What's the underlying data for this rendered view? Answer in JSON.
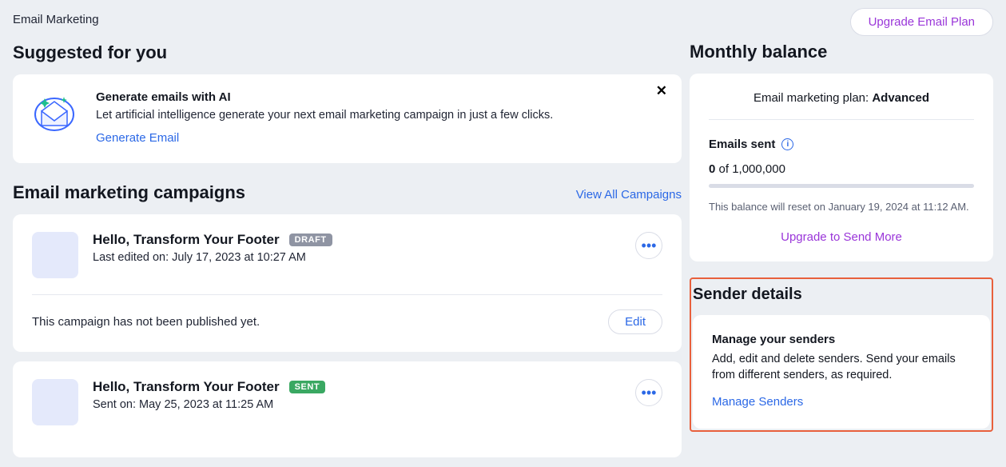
{
  "header": {
    "page_label": "Email Marketing",
    "upgrade_button": "Upgrade Email Plan"
  },
  "suggested": {
    "heading": "Suggested for you",
    "title": "Generate emails with AI",
    "description": "Let artificial intelligence generate your next email marketing campaign in just a few clicks.",
    "cta": "Generate Email"
  },
  "campaigns": {
    "heading": "Email marketing campaigns",
    "view_all": "View All Campaigns",
    "items": [
      {
        "title": "Hello, Transform Your Footer",
        "badge": "DRAFT",
        "subline": "Last edited on: July 17, 2023 at 10:27 AM",
        "status_text": "This campaign has not been published yet.",
        "action": "Edit"
      },
      {
        "title": "Hello, Transform Your Footer",
        "badge": "SENT",
        "subline": "Sent on: May 25, 2023 at 11:25 AM"
      }
    ]
  },
  "balance": {
    "heading": "Monthly balance",
    "plan_prefix": "Email marketing plan: ",
    "plan_name": "Advanced",
    "emails_sent_label": "Emails sent",
    "sent_value": "0",
    "sent_of": " of 1,000,000",
    "reset_note": "This balance will reset on January 19, 2024 at 11:12 AM.",
    "upgrade_more": "Upgrade to Send More"
  },
  "sender": {
    "heading": "Sender details",
    "title": "Manage your senders",
    "description": "Add, edit and delete senders. Send your emails from different senders, as required.",
    "cta": "Manage Senders"
  }
}
